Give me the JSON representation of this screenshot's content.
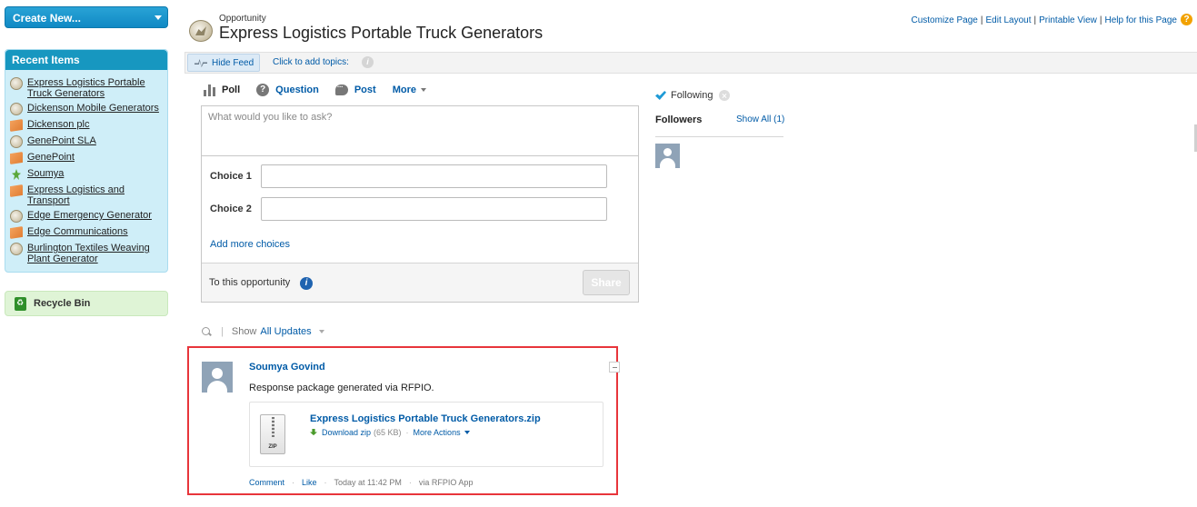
{
  "sidebar": {
    "create_new": "Create New...",
    "recent_title": "Recent Items",
    "recent_items": [
      {
        "label": "Express Logistics Portable Truck Generators",
        "icon": "opportunity-icon"
      },
      {
        "label": "Dickenson Mobile Generators",
        "icon": "opportunity-icon"
      },
      {
        "label": "Dickenson plc",
        "icon": "account-icon"
      },
      {
        "label": "GenePoint SLA",
        "icon": "opportunity-icon"
      },
      {
        "label": "GenePoint",
        "icon": "account-icon"
      },
      {
        "label": "Soumya",
        "icon": "contact-icon"
      },
      {
        "label": "Express Logistics and Transport",
        "icon": "account-icon"
      },
      {
        "label": "Edge Emergency Generator",
        "icon": "opportunity-icon"
      },
      {
        "label": "Edge Communications",
        "icon": "account-icon"
      },
      {
        "label": "Burlington Textiles Weaving Plant Generator",
        "icon": "opportunity-icon"
      }
    ],
    "recycle_bin": "Recycle Bin"
  },
  "header": {
    "object_type": "Opportunity",
    "title": "Express Logistics Portable Truck Generators",
    "links": [
      "Customize Page",
      "Edit Layout",
      "Printable View",
      "Help for this Page"
    ],
    "help_icon": "?"
  },
  "feed_bar": {
    "hide_feed": "Hide Feed",
    "add_topics": "Click to add topics:",
    "info_icon": "i"
  },
  "publisher": {
    "tabs": [
      {
        "label": "Poll",
        "icon": "poll-icon"
      },
      {
        "label": "Question",
        "icon": "question-icon",
        "glyph": "?"
      },
      {
        "label": "Post",
        "icon": "post-icon"
      },
      {
        "label": "More",
        "icon": "chevron-down-icon"
      }
    ],
    "ask_placeholder": "What would you like to ask?",
    "choices": [
      {
        "label": "Choice 1",
        "value": ""
      },
      {
        "label": "Choice 2",
        "value": ""
      }
    ],
    "add_more": "Add more choices",
    "to_this": "To this opportunity",
    "info_icon": "i",
    "share": "Share"
  },
  "filter": {
    "separator": "|",
    "show_label": "Show",
    "show_value": "All Updates"
  },
  "feed_item": {
    "author": "Soumya Govind",
    "message": "Response package generated via RFPIO.",
    "file": {
      "name": "Express Logistics Portable Truck Generators.zip",
      "type_label": "ZIP",
      "download": "Download zip",
      "size": "(65 KB)",
      "dot": "·",
      "more_actions": "More Actions"
    },
    "footer": {
      "comment": "Comment",
      "like": "Like",
      "timestamp": "Today at 11:42 PM",
      "source": "via RFPIO App",
      "dot": "·"
    }
  },
  "following": {
    "status": "Following",
    "followers_label": "Followers",
    "show_all": "Show All (1)"
  },
  "colors": {
    "link": "#015ba7",
    "highlight_border": "#e8353b",
    "recent_header": "#1797c0"
  }
}
